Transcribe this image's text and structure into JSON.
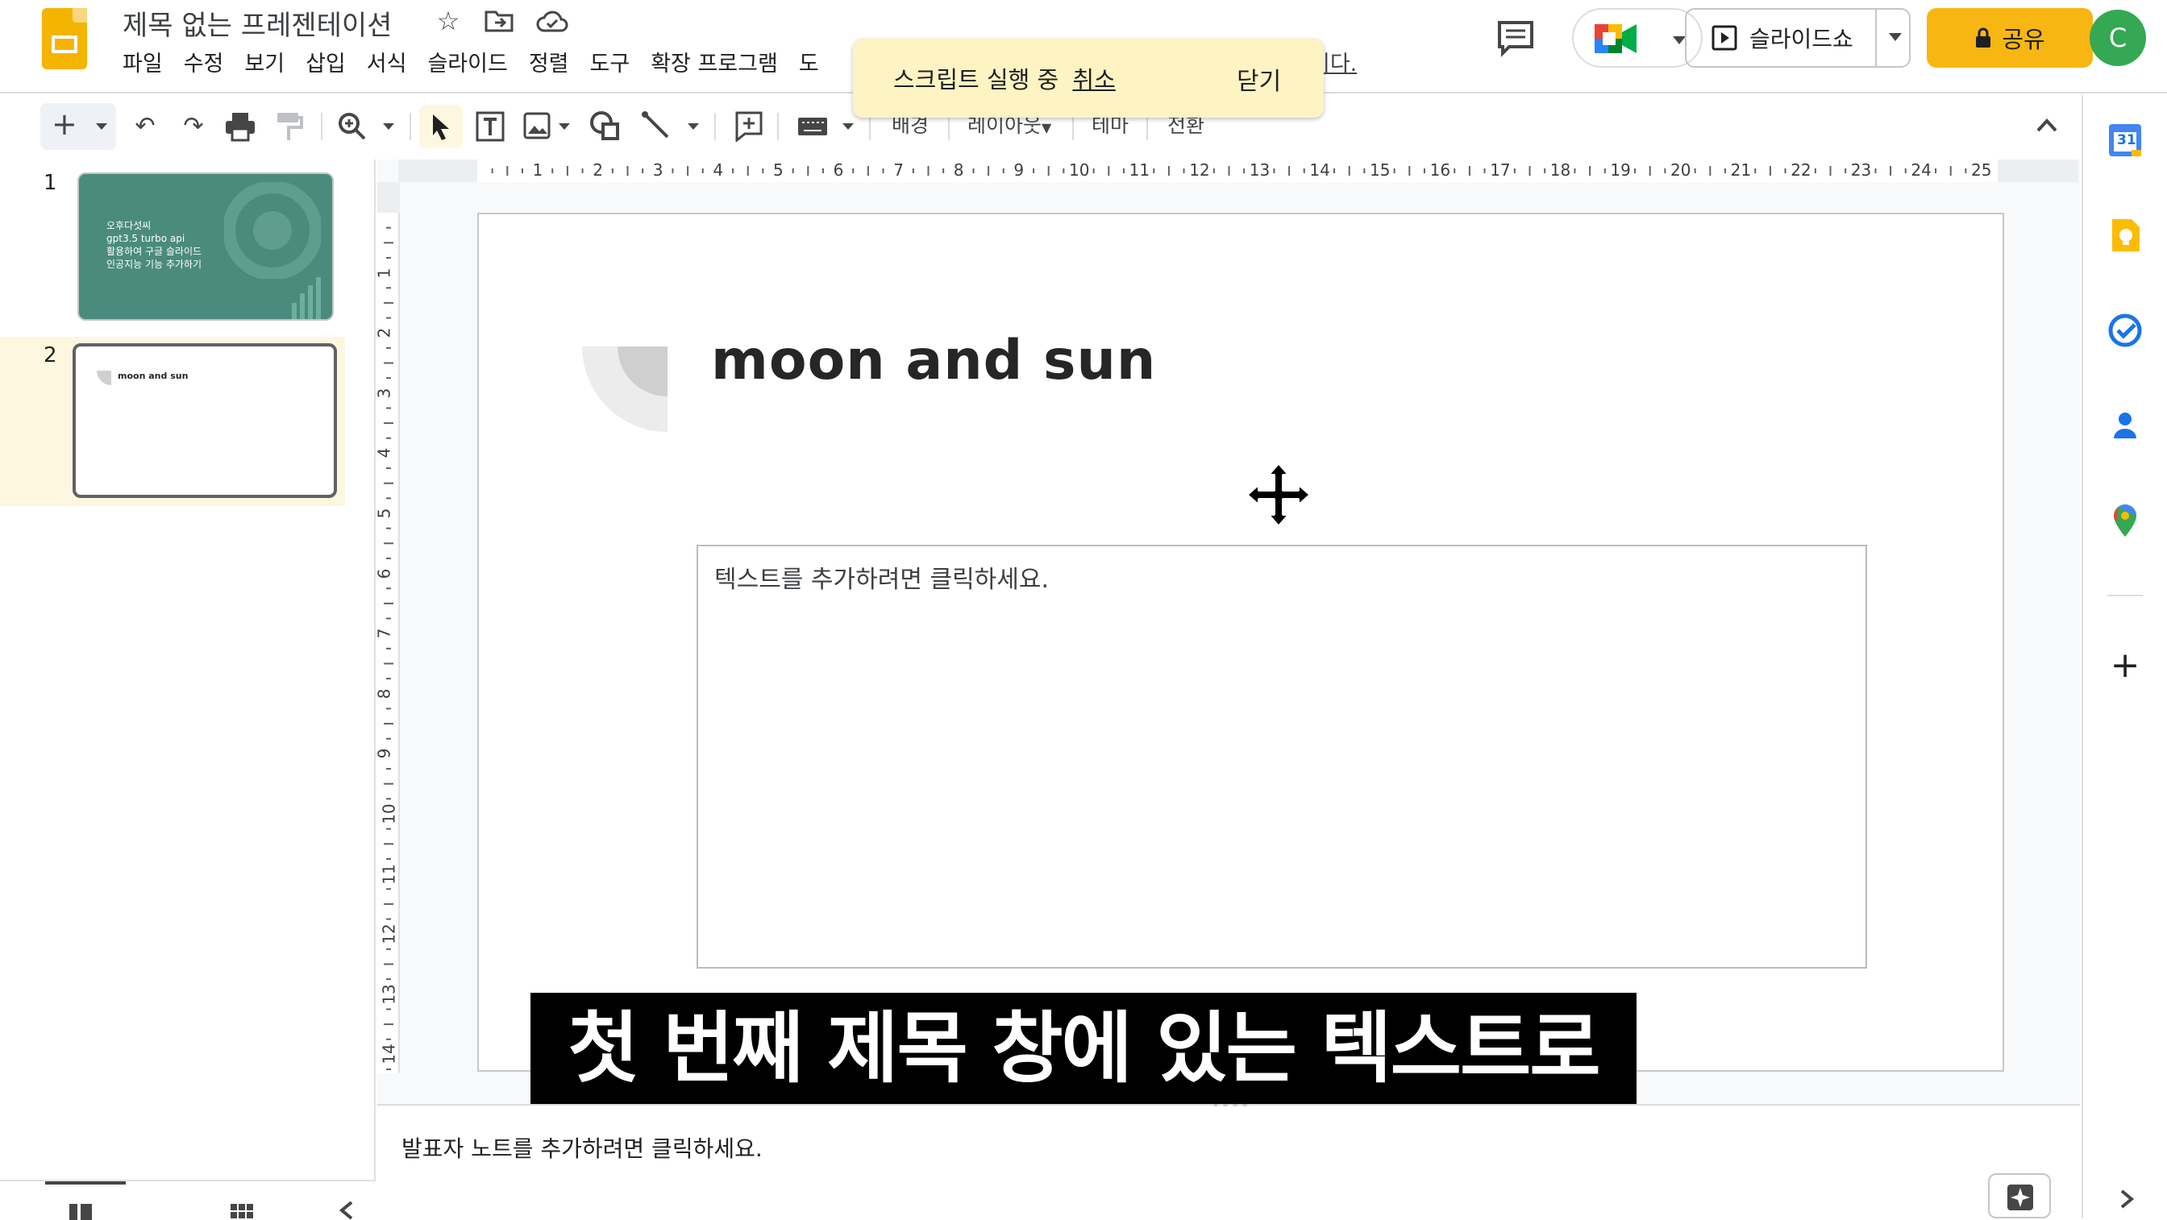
{
  "app": {
    "doc_title": "제목 없는 프레젠테이션",
    "menu": [
      "파일",
      "수정",
      "보기",
      "삽입",
      "서식",
      "슬라이드",
      "정렬",
      "도구",
      "확장 프로그램",
      "도"
    ],
    "menu_hidden_text": "니다.",
    "avatar_letter": "C",
    "accent_color": "#f7b611",
    "brand_color": "#f4b400"
  },
  "toast": {
    "message": "스크립트 실행 중",
    "cancel_label": "취소",
    "close_label": "닫기"
  },
  "header_buttons": {
    "slideshow_label": "슬라이드쇼",
    "share_label": "공유"
  },
  "toolbar": {
    "background_label": "배경",
    "layout_label": "레이아웃",
    "theme_label": "테마",
    "transition_label": "전환"
  },
  "filmstrip": {
    "slides": [
      {
        "number": "1",
        "text_lines": [
          "오후다섯씨",
          "gpt3.5 turbo api",
          "활용하여 구글 슬라이드",
          "인공지능 기능 추가하기"
        ]
      },
      {
        "number": "2",
        "title": "moon and sun"
      }
    ]
  },
  "rulers": {
    "horizontal_labels": [
      "1",
      "2",
      "3",
      "4",
      "5",
      "6",
      "7",
      "8",
      "9",
      "10",
      "11",
      "12",
      "13",
      "14",
      "15",
      "16",
      "17",
      "18",
      "19",
      "20",
      "21",
      "22",
      "23",
      "24",
      "25"
    ],
    "vertical_labels": [
      "1",
      "2",
      "3",
      "4",
      "5",
      "6",
      "7",
      "8",
      "9",
      "10",
      "11",
      "12",
      "13",
      "14"
    ]
  },
  "slide": {
    "title": "moon and sun",
    "body_placeholder": "텍스트를 추가하려면 클릭하세요."
  },
  "notes": {
    "placeholder": "발표자 노트를 추가하려면 클릭하세요."
  },
  "caption": "첫 번째 제목 창에 있는 텍스트로",
  "side_panel": {
    "calendar_day": "31"
  }
}
